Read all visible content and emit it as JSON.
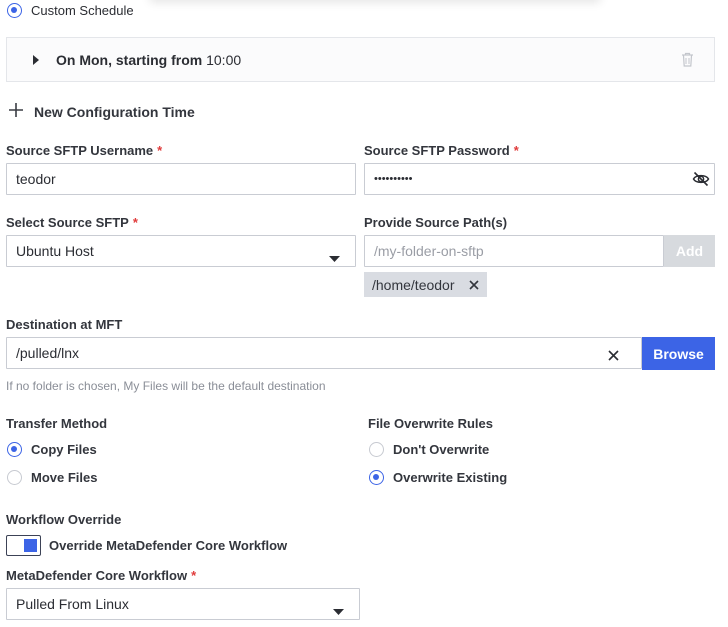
{
  "schedule": {
    "custom_label": "Custom Schedule",
    "entry_prefix": "On Mon, starting from ",
    "entry_time": "10:00",
    "new_config_label": "New Configuration Time"
  },
  "username": {
    "label": "Source SFTP Username",
    "value": "teodor"
  },
  "password": {
    "label": "Source SFTP Password",
    "value": "••••••••••"
  },
  "source_sftp": {
    "label": "Select Source SFTP",
    "value": "Ubuntu Host"
  },
  "source_path": {
    "label": "Provide Source Path(s)",
    "placeholder": "/my-folder-on-sftp",
    "add_label": "Add",
    "paths": [
      "/home/teodor"
    ]
  },
  "destination": {
    "label": "Destination at MFT",
    "value": "/pulled/lnx",
    "browse_label": "Browse",
    "hint": "If no folder is chosen, My Files will be the default destination"
  },
  "transfer_method": {
    "label": "Transfer Method",
    "options": [
      {
        "label": "Copy Files",
        "selected": true
      },
      {
        "label": "Move Files",
        "selected": false
      }
    ]
  },
  "overwrite_rules": {
    "label": "File Overwrite Rules",
    "options": [
      {
        "label": "Don't Overwrite",
        "selected": false
      },
      {
        "label": "Overwrite Existing",
        "selected": true
      }
    ]
  },
  "workflow_override": {
    "label": "Workflow Override",
    "toggle_label": "Override MetaDefender Core Workflow",
    "enabled": true
  },
  "core_workflow": {
    "label": "MetaDefender Core Workflow",
    "value": "Pulled From Linux"
  },
  "required_mark": "*",
  "colors": {
    "accent": "#3c64e6",
    "required": "#e03b3b",
    "disabled_button": "#d7dade"
  }
}
